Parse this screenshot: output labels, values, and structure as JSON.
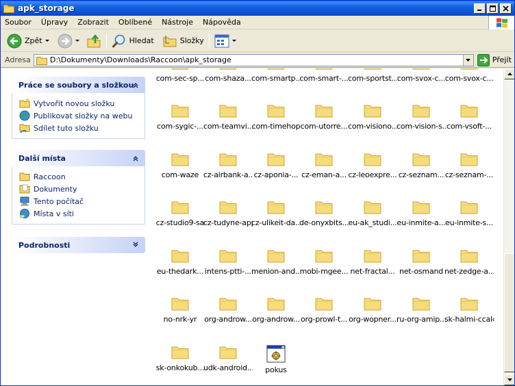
{
  "window": {
    "title": "apk_storage"
  },
  "menu": [
    "Soubor",
    "Úpravy",
    "Zobrazit",
    "Oblíbené",
    "Nástroje",
    "Nápověda"
  ],
  "toolbar": {
    "back_label": "Zpět",
    "search_label": "Hledat",
    "folders_label": "Složky"
  },
  "address": {
    "label": "Adresa",
    "path": "D:\\Dokumenty\\Downloads\\Raccoon\\apk_storage",
    "go_label": "Přejít"
  },
  "tasks_panel": {
    "title": "Práce se soubory a složkou",
    "items": [
      "Vytvořit novou složku",
      "Publikovat složky na webu",
      "Sdílet tuto složku"
    ]
  },
  "places_panel": {
    "title": "Další místa",
    "items": [
      "Raccoon",
      "Dokumenty",
      "Tento počítač",
      "Místa v síti"
    ]
  },
  "details_panel": {
    "title": "Podrobnosti"
  },
  "files": [
    "com-sec-sp...",
    "com-shaza...",
    "com-smartp...",
    "com-smart-...",
    "com-sportst...",
    "com-svox-c...",
    "com-svox-c...",
    "com-sygic-...",
    "com-teamvi...",
    "com-timehop",
    "com-utorre...",
    "com-visiono...",
    "com-vision-s...",
    "com-vsoft-...",
    "com-waze",
    "cz-airbank-a...",
    "cz-aponia-...",
    "cz-eman-a...",
    "cz-leoexpre...",
    "cz-seznam...",
    "cz-seznam-...",
    "cz-studio9-sa",
    "cz-tudyne-app",
    "cz-ulikeit-da...",
    "de-onyxbits...",
    "eu-ak_studi...",
    "eu-inmite-a...",
    "eu-inmite-s...",
    "eu-thedark...",
    "intens-ptti-...",
    "menion-and...",
    "mobi-mgee...",
    "net-fractal...",
    "net-osmand",
    "net-zedge-a...",
    "no-nrk-yr",
    "org-androw...",
    "org-androw...",
    "org-prowl-t...",
    "org-wopner...",
    "ru-org-amip...",
    "sk-halmi-ccalc",
    "sk-onkokub...",
    "udk-android...",
    "pokus"
  ]
}
